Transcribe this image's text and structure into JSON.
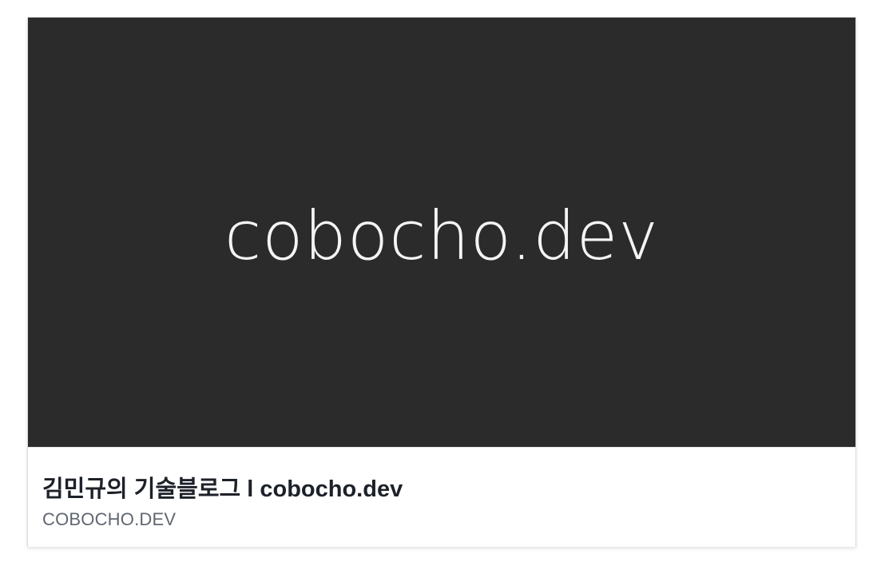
{
  "link_card": {
    "preview_text": "cobocho.dev",
    "title": "김민규의 기술블로그 l cobocho.dev",
    "domain": "COBOCHO.DEV"
  },
  "colors": {
    "preview_background": "#2b2b2b",
    "title_text": "#1d2129",
    "domain_text": "#606770"
  }
}
